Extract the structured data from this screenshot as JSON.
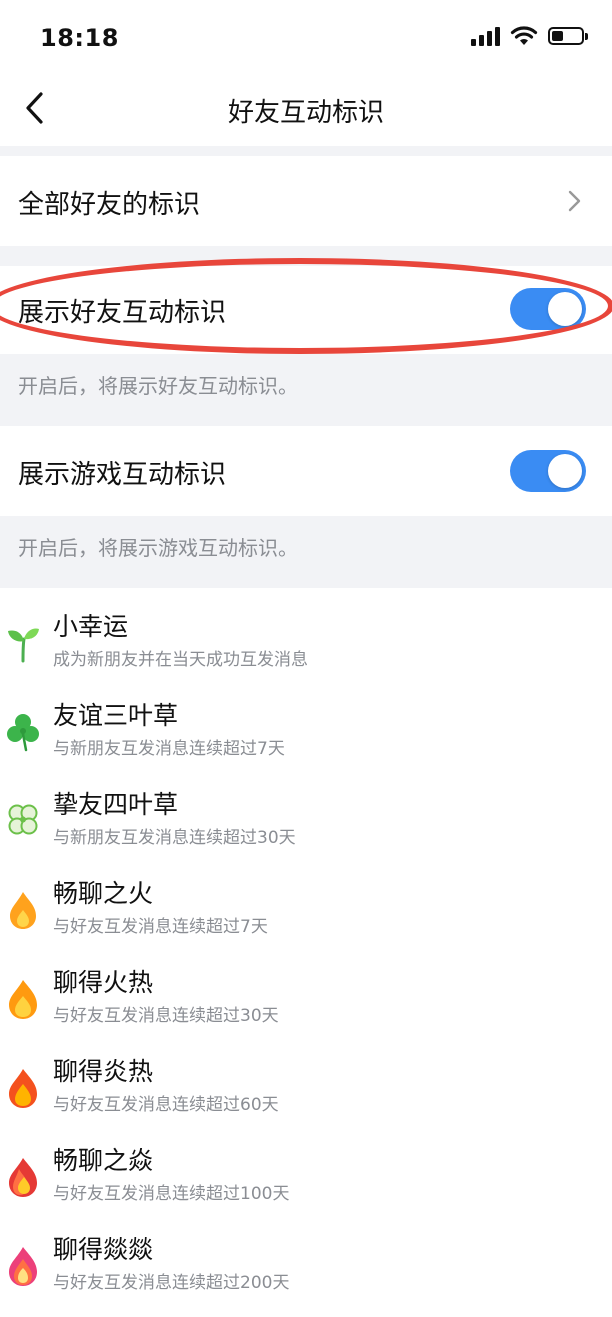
{
  "status_bar": {
    "time": "18:18",
    "signal_icon": "signal-bars-icon",
    "wifi_icon": "wifi-icon",
    "battery_icon": "battery-icon",
    "battery_level": 0.4
  },
  "nav": {
    "back_icon": "chevron-left-icon",
    "title": "好友互动标识"
  },
  "all_friends_row": {
    "label": "全部好友的标识",
    "icon": "chevron-right-icon"
  },
  "friend_toggle": {
    "label": "展示好友互动标识",
    "enabled": true,
    "hint": "开启后，将展示好友互动标识。",
    "highlight_color": "#e8463b"
  },
  "game_toggle": {
    "label": "展示游戏互动标识",
    "enabled": true,
    "hint": "开启后，将展示游戏互动标识。"
  },
  "colors": {
    "toggle_on": "#3a8cf3",
    "section_gap": "#f2f3f6",
    "hint_text": "#8a8d93"
  },
  "badges": [
    {
      "title": "小幸运",
      "desc": "成为新朋友并在当天成功互发消息",
      "icon": "sprout-icon"
    },
    {
      "title": "友谊三叶草",
      "desc": "与新朋友互发消息连续超过7天",
      "icon": "three-leaf-clover-icon"
    },
    {
      "title": "挚友四叶草",
      "desc": "与新朋友互发消息连续超过30天",
      "icon": "four-leaf-clover-icon"
    },
    {
      "title": "畅聊之火",
      "desc": "与好友互发消息连续超过7天",
      "icon": "small-flame-icon"
    },
    {
      "title": "聊得火热",
      "desc": "与好友互发消息连续超过30天",
      "icon": "flame-icon"
    },
    {
      "title": "聊得炎热",
      "desc": "与好友互发消息连续超过60天",
      "icon": "red-flame-icon"
    },
    {
      "title": "畅聊之焱",
      "desc": "与好友互发消息连续超过100天",
      "icon": "double-flame-icon"
    },
    {
      "title": "聊得燚燚",
      "desc": "与好友互发消息连续超过200天",
      "icon": "pink-flame-icon"
    }
  ]
}
